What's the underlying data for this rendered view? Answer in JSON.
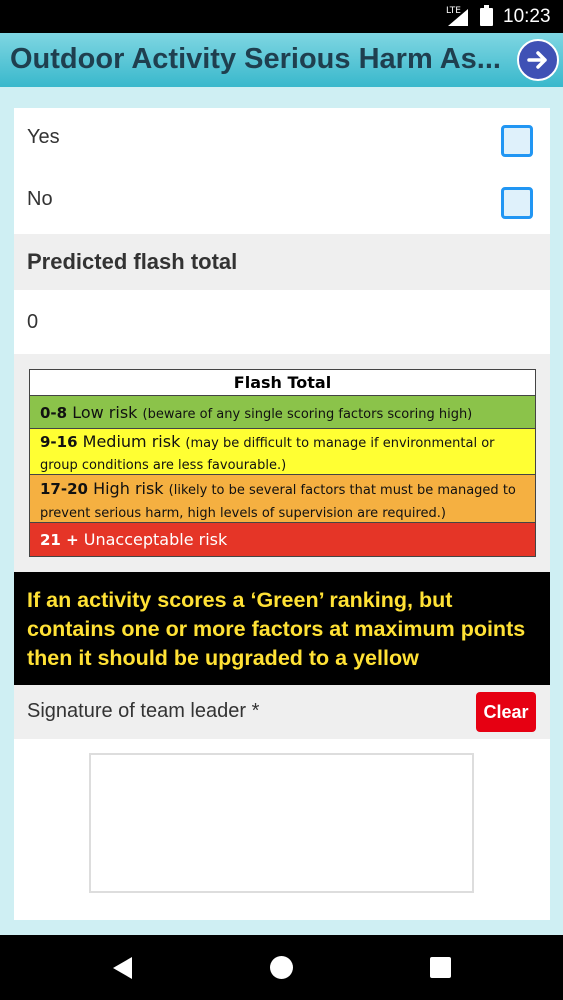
{
  "status_bar": {
    "network": "LTE",
    "time": "10:23"
  },
  "app_bar": {
    "title": "Outdoor Activity Serious Harm As..."
  },
  "options": [
    {
      "label": "Yes",
      "checked": false
    },
    {
      "label": "No",
      "checked": false
    }
  ],
  "predicted": {
    "header": "Predicted flash total",
    "value": "0"
  },
  "flash_table": {
    "title": "Flash Total",
    "rows": [
      {
        "range": "0-8",
        "name": "Low risk",
        "description": "(beware of any single scoring factors scoring high)",
        "color": "#8bc34a"
      },
      {
        "range": "9-16",
        "name": "Medium risk",
        "description": "(may be difficult to manage if environmental or group conditions are less favourable.)",
        "color": "#ffff33"
      },
      {
        "range": "17-20",
        "name": "High risk",
        "description": "(likely to be several factors that must be managed to prevent serious harm, high levels of supervision are required.)",
        "color": "#f5b041"
      },
      {
        "range": "21 +",
        "name": "Unacceptable risk",
        "description": "",
        "color": "#e53527"
      }
    ]
  },
  "warning": {
    "text": "If an activity scores a ‘Green’ ranking, but contains one or more factors at maximum points then it should be upgraded to a yellow"
  },
  "signature": {
    "label": "Signature of team leader *",
    "clear_label": "Clear"
  }
}
